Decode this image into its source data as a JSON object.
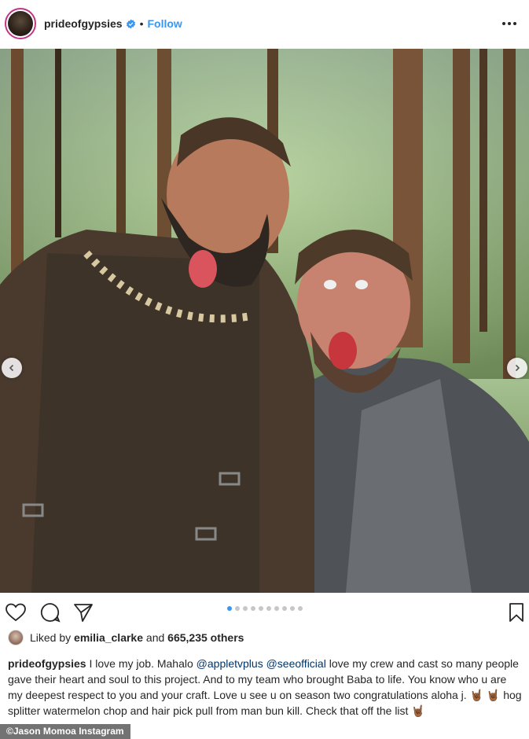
{
  "post": {
    "username": "prideofgypsies",
    "separator": "•",
    "follow_label": "Follow",
    "more_icon": "more-horizontal-icon",
    "verified_icon": "verified-badge-icon",
    "carousel": {
      "total": 10,
      "active_index": 0
    },
    "likes": {
      "prefix": "Liked by",
      "liker": "emilia_clarke",
      "middle": "and",
      "others": "665,235 others"
    },
    "caption": {
      "username": "prideofgypsies",
      "t1": " I love my job. Mahalo ",
      "mention1": "@appletvplus",
      "t2": " ",
      "mention2": "@seeofficial",
      "t3": " love my crew and cast so many people gave their heart and soul to this project. And to my team who brought Baba to life. You know who u are my deepest respect to you and your craft. Love u see u on season two congratulations aloha j. ",
      "emoji": "🤘🏾",
      "t4": " hog splitter watermelon chop and hair pick pull from man bun kill. Check that off the list "
    }
  },
  "credit": "©Jason Momoa Instagram",
  "colors": {
    "accent": "#3897f0",
    "text": "#262626",
    "dot_inactive": "#c7c7c7"
  }
}
